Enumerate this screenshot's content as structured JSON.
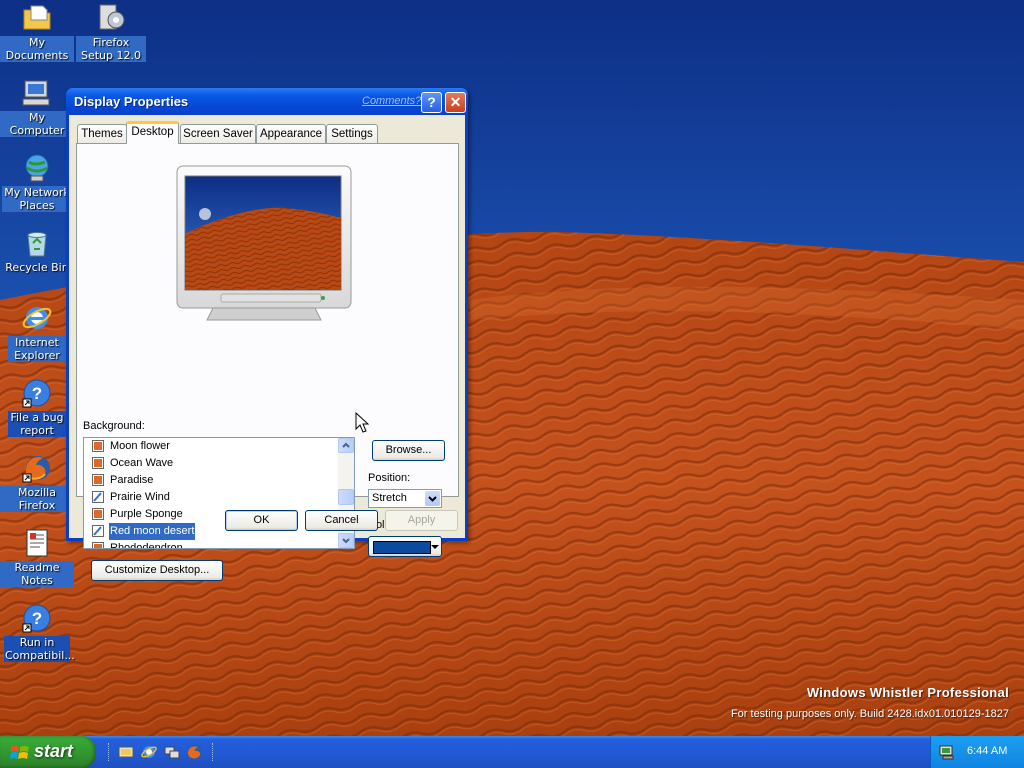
{
  "desktop": {
    "icons": [
      {
        "label": "My Documents"
      },
      {
        "label": "Firefox Setup 12.0"
      },
      {
        "label": "My Computer"
      },
      {
        "label": "My Network Places"
      },
      {
        "label": "Recycle Bin"
      },
      {
        "label": "Internet Explorer"
      },
      {
        "label": "File a bug report"
      },
      {
        "label": "Mozilla Firefox"
      },
      {
        "label": "Readme Notes"
      },
      {
        "label": "Run in Compatibil..."
      }
    ],
    "watermark": {
      "title": "Windows Whistler Professional",
      "build": "For testing purposes only. Build 2428.idx01.010129-1827"
    }
  },
  "dialog": {
    "title": "Display Properties",
    "comments_link": "Comments?",
    "help_glyph": "?",
    "close_glyph": "✕",
    "tabs": [
      {
        "label": "Themes"
      },
      {
        "label": "Desktop"
      },
      {
        "label": "Screen Saver"
      },
      {
        "label": "Appearance"
      },
      {
        "label": "Settings"
      }
    ],
    "active_tab": "Desktop",
    "background_label": "Background:",
    "background_items": [
      {
        "label": "Moon flower"
      },
      {
        "label": "Ocean Wave"
      },
      {
        "label": "Paradise"
      },
      {
        "label": "Prairie Wind"
      },
      {
        "label": "Purple Sponge"
      },
      {
        "label": "Red moon desert"
      },
      {
        "label": "Rhododendron"
      }
    ],
    "selected_background": "Red moon desert",
    "browse_label": "Browse...",
    "position_label": "Position:",
    "position_value": "Stretch",
    "color_label": "Color:",
    "color_value": "#0b4a9c",
    "customize_label": "Customize Desktop...",
    "ok_label": "OK",
    "cancel_label": "Cancel",
    "apply_label": "Apply"
  },
  "taskbar": {
    "start_label": "start",
    "clock": "6:44 AM"
  },
  "colors": {
    "xp_blue": "#0a3ec4",
    "selection": "#316ac5",
    "start_green": "#36a535",
    "desert_red": "#c8501e",
    "sky_blue": "#1b4fa8"
  }
}
